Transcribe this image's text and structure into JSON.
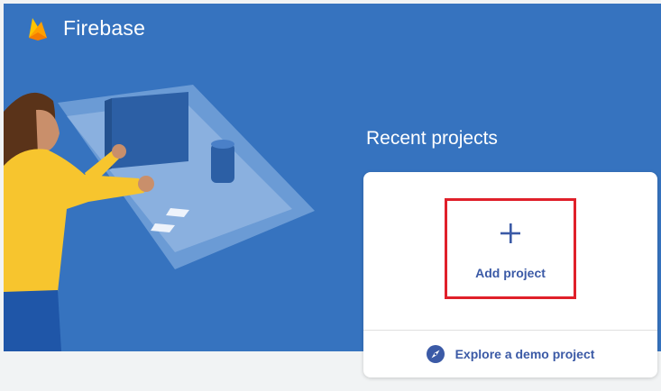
{
  "header": {
    "brand": "Firebase",
    "logo_icon": "firebase-flame-icon"
  },
  "recent": {
    "title": "Recent projects",
    "add_project": {
      "label": "Add project",
      "icon": "plus-icon"
    },
    "explore_demo": {
      "label": "Explore a demo project",
      "icon": "compass-icon"
    }
  },
  "colors": {
    "banner": "#3673bf",
    "accent_text": "#3b5aa6",
    "highlight": "#e0202a",
    "page_background": "#f1f3f4"
  }
}
